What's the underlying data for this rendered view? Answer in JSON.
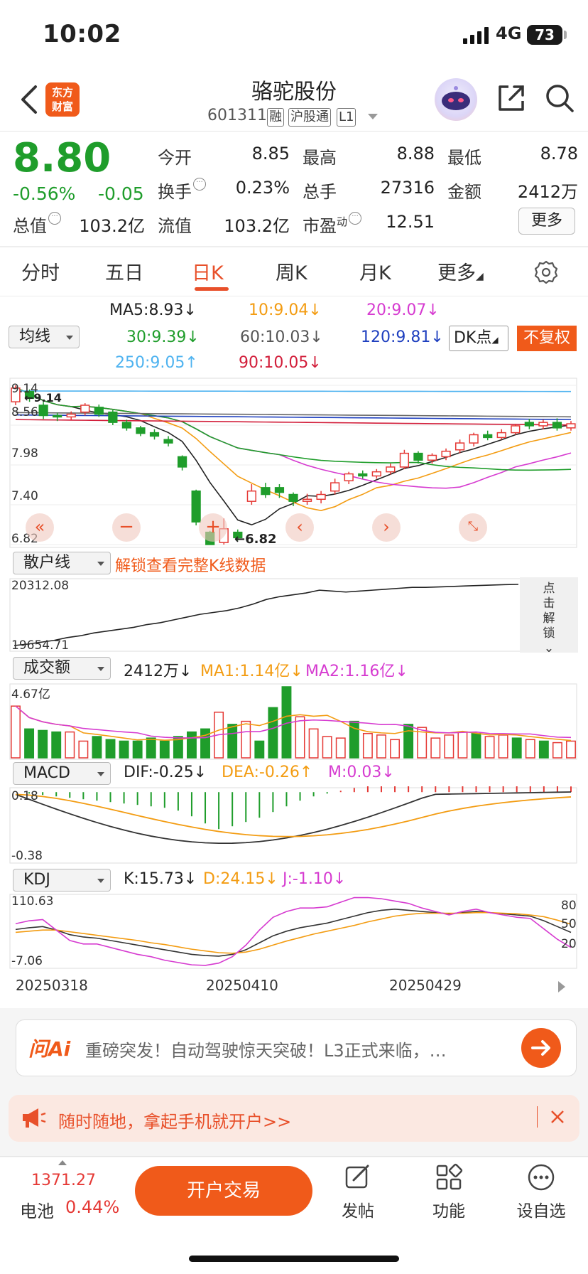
{
  "status": {
    "time": "10:02",
    "network": "4G",
    "battery": "73"
  },
  "header": {
    "logo_line1": "东方",
    "logo_line2": "财富",
    "name": "骆驼股份",
    "code": "601311",
    "tags": [
      "融",
      "沪股通",
      "L1"
    ]
  },
  "quote": {
    "price": "8.80",
    "pct": "-0.56%",
    "chg": "-0.05",
    "fields": [
      {
        "label": "今开",
        "value": "8.85"
      },
      {
        "label": "最高",
        "value": "8.88"
      },
      {
        "label": "最低",
        "value": "8.78"
      },
      {
        "label": "换手",
        "value": "0.23%"
      },
      {
        "label": "总手",
        "value": "27316"
      },
      {
        "label": "金额",
        "value": "2412万"
      },
      {
        "label": "总值",
        "value": "103.2亿"
      },
      {
        "label": "流值",
        "value": "103.2亿"
      },
      {
        "label": "市盈",
        "value": "12.51"
      }
    ],
    "pe_sup": "动",
    "more": "更多"
  },
  "tabs": [
    "分时",
    "五日",
    "日K",
    "周K",
    "月K",
    "更多"
  ],
  "ma": {
    "select": "均线",
    "ma5": "MA5:8.93",
    "ma10": "10:9.04",
    "ma20": "20:9.07",
    "ma30": "30:9.39",
    "ma60": "60:10.03",
    "ma120": "120:9.81",
    "ma250": "250:9.05",
    "ma90": "90:10.05",
    "dk": "DK点",
    "fq": "不复权"
  },
  "price_axis": [
    "9.14",
    "8.56",
    "7.98",
    "7.40",
    "6.82"
  ],
  "price_marks": {
    "high": "9.14",
    "low": "6.82"
  },
  "retail": {
    "select": "散户线",
    "unlock": "解锁查看完整K线数据",
    "ymax": "20312.08",
    "ymin": "19654.71",
    "side": [
      "点",
      "击",
      "解",
      "锁"
    ]
  },
  "volume": {
    "select": "成交额",
    "value": "2412万",
    "ma1": "MA1:1.14亿",
    "ma2": "MA2:1.16亿",
    "ymax": "4.67亿"
  },
  "macd": {
    "select": "MACD",
    "dif": "DIF:-0.25",
    "dea": "DEA:-0.26",
    "m": "M:0.03",
    "ymax": "0.18",
    "ymin": "-0.38"
  },
  "kdj": {
    "select": "KDJ",
    "k": "K:15.73",
    "d": "D:24.15",
    "j": "J:-1.10",
    "ymax": "110.63",
    "ymin": "-7.06",
    "right": [
      "80",
      "50",
      "20"
    ]
  },
  "dates": [
    "20250318",
    "20250410",
    "20250429"
  ],
  "ai": {
    "logo": "问Ai",
    "text": "重磅突发！自动驾驶惊天突破！L3正式来临，…"
  },
  "promo": {
    "text": "随时随地，拿起手机就开户>>"
  },
  "bottom": {
    "index_value": "1371.27",
    "index_name": "电池",
    "index_pct": "0.44%",
    "trade": "开户交易",
    "nav": [
      "发帖",
      "功能",
      "设自选"
    ]
  },
  "chart_data": [
    {
      "type": "candlestick",
      "series": [
        {
          "name": "MA5",
          "value": 8.93
        },
        {
          "name": "10",
          "value": 9.04
        },
        {
          "name": "20",
          "value": 9.07
        },
        {
          "name": "30",
          "value": 9.39
        },
        {
          "name": "60",
          "value": 10.03
        },
        {
          "name": "120",
          "value": 9.81
        },
        {
          "name": "250",
          "value": 9.05
        },
        {
          "name": "90",
          "value": 10.05
        }
      ],
      "ylim": [
        6.82,
        9.14
      ],
      "ticks": [
        9.14,
        8.56,
        7.98,
        7.4,
        6.82
      ],
      "annotations": [
        "9.14",
        "6.82"
      ],
      "candles": [
        {
          "o": 8.9,
          "c": 9.1,
          "h": 9.14,
          "l": 8.85
        },
        {
          "o": 9.05,
          "c": 8.95,
          "h": 9.08,
          "l": 8.9
        },
        {
          "o": 8.85,
          "c": 8.7,
          "h": 8.9,
          "l": 8.65
        },
        {
          "o": 8.7,
          "c": 8.68,
          "h": 8.74,
          "l": 8.62
        },
        {
          "o": 8.68,
          "c": 8.72,
          "h": 8.76,
          "l": 8.64
        },
        {
          "o": 8.75,
          "c": 8.85,
          "h": 8.88,
          "l": 8.7
        },
        {
          "o": 8.82,
          "c": 8.72,
          "h": 8.86,
          "l": 8.68
        },
        {
          "o": 8.75,
          "c": 8.6,
          "h": 8.78,
          "l": 8.56
        },
        {
          "o": 8.6,
          "c": 8.52,
          "h": 8.64,
          "l": 8.48
        },
        {
          "o": 8.52,
          "c": 8.44,
          "h": 8.55,
          "l": 8.4
        },
        {
          "o": 8.45,
          "c": 8.4,
          "h": 8.5,
          "l": 8.35
        },
        {
          "o": 8.35,
          "c": 8.3,
          "h": 8.4,
          "l": 8.25
        },
        {
          "o": 8.1,
          "c": 7.95,
          "h": 8.12,
          "l": 7.9
        },
        {
          "o": 7.6,
          "c": 7.15,
          "h": 7.62,
          "l": 7.1
        },
        {
          "o": 7.0,
          "c": 6.82,
          "h": 7.02,
          "l": 6.82
        },
        {
          "o": 6.85,
          "c": 7.05,
          "h": 7.2,
          "l": 6.82
        },
        {
          "o": 7.0,
          "c": 6.92,
          "h": 7.04,
          "l": 6.88
        },
        {
          "o": 7.45,
          "c": 7.6,
          "h": 7.7,
          "l": 7.4
        },
        {
          "o": 7.65,
          "c": 7.55,
          "h": 7.72,
          "l": 7.5
        },
        {
          "o": 7.65,
          "c": 7.58,
          "h": 7.7,
          "l": 7.5
        },
        {
          "o": 7.55,
          "c": 7.45,
          "h": 7.58,
          "l": 7.38
        },
        {
          "o": 7.45,
          "c": 7.48,
          "h": 7.56,
          "l": 7.4
        },
        {
          "o": 7.48,
          "c": 7.55,
          "h": 7.6,
          "l": 7.42
        },
        {
          "o": 7.6,
          "c": 7.72,
          "h": 7.78,
          "l": 7.55
        },
        {
          "o": 7.75,
          "c": 7.85,
          "h": 7.88,
          "l": 7.7
        },
        {
          "o": 7.85,
          "c": 7.82,
          "h": 7.9,
          "l": 7.78
        },
        {
          "o": 7.82,
          "c": 7.88,
          "h": 7.92,
          "l": 7.78
        },
        {
          "o": 7.88,
          "c": 7.95,
          "h": 8.0,
          "l": 7.84
        },
        {
          "o": 7.95,
          "c": 8.15,
          "h": 8.2,
          "l": 7.92
        },
        {
          "o": 8.15,
          "c": 8.05,
          "h": 8.18,
          "l": 8.0
        },
        {
          "o": 8.05,
          "c": 8.12,
          "h": 8.15,
          "l": 8.0
        },
        {
          "o": 8.1,
          "c": 8.18,
          "h": 8.22,
          "l": 8.05
        },
        {
          "o": 8.2,
          "c": 8.3,
          "h": 8.35,
          "l": 8.15
        },
        {
          "o": 8.3,
          "c": 8.42,
          "h": 8.45,
          "l": 8.25
        },
        {
          "o": 8.42,
          "c": 8.38,
          "h": 8.48,
          "l": 8.34
        },
        {
          "o": 8.38,
          "c": 8.45,
          "h": 8.5,
          "l": 8.35
        },
        {
          "o": 8.45,
          "c": 8.55,
          "h": 8.58,
          "l": 8.42
        },
        {
          "o": 8.6,
          "c": 8.55,
          "h": 8.65,
          "l": 8.5
        },
        {
          "o": 8.55,
          "c": 8.6,
          "h": 8.64,
          "l": 8.5
        },
        {
          "o": 8.6,
          "c": 8.52,
          "h": 8.66,
          "l": 8.48
        },
        {
          "o": 8.52,
          "c": 8.58,
          "h": 8.62,
          "l": 8.48
        }
      ],
      "xlabels": [
        "20250318",
        "20250410",
        "20250429"
      ]
    },
    {
      "type": "line",
      "title": "散户线",
      "ylim": [
        19654.71,
        20312.08
      ],
      "values": [
        19654.71,
        19670,
        19690,
        19710,
        19740,
        19760,
        19790,
        19810,
        19830,
        19850,
        19880,
        19900,
        19930,
        19960,
        19990,
        20010,
        20030,
        20060,
        20100,
        20150,
        20180,
        20200,
        20220,
        20250,
        20240,
        20230,
        20240,
        20250,
        20260,
        20270,
        20280,
        20280,
        20285,
        20290,
        20295,
        20300,
        20305,
        20310,
        20312.08
      ]
    },
    {
      "type": "bar",
      "title": "成交额",
      "ylim": [
        0,
        4.67
      ],
      "values": [
        3.4,
        1.9,
        1.8,
        1.7,
        1.7,
        1.1,
        1.4,
        1.2,
        1.1,
        1.1,
        1.3,
        1.1,
        1.4,
        1.7,
        1.9,
        3.0,
        2.2,
        2.4,
        1.1,
        3.3,
        4.67,
        2.7,
        1.9,
        1.4,
        1.3,
        2.4,
        1.6,
        1.5,
        1.2,
        2.2,
        2.0,
        1.3,
        1.5,
        1.7,
        1.6,
        1.4,
        1.5,
        1.3,
        1.2,
        1.1,
        1.0,
        1.1
      ],
      "series": [
        {
          "name": "MA1",
          "value": "1.14亿"
        },
        {
          "name": "MA2",
          "value": "1.16亿"
        }
      ]
    },
    {
      "type": "bar",
      "title": "MACD",
      "ylim": [
        -0.38,
        0.18
      ],
      "values": [
        0.0,
        -0.01,
        -0.02,
        -0.03,
        -0.04,
        -0.05,
        -0.06,
        -0.07,
        -0.08,
        -0.09,
        -0.1,
        -0.11,
        -0.13,
        -0.17,
        -0.22,
        -0.26,
        -0.24,
        -0.21,
        -0.18,
        -0.14,
        -0.1,
        -0.06,
        -0.03,
        -0.01,
        0.01,
        0.03,
        0.05,
        0.07,
        0.09,
        0.11,
        0.12,
        0.12,
        0.12,
        0.12,
        0.12,
        0.11,
        0.1,
        0.09,
        0.08,
        0.06,
        0.05,
        0.04
      ],
      "series": [
        {
          "name": "DIF",
          "value": -0.25
        },
        {
          "name": "DEA",
          "value": -0.26
        },
        {
          "name": "M",
          "value": 0.03
        }
      ]
    },
    {
      "type": "line",
      "title": "KDJ",
      "ylim": [
        -7.06,
        110.63
      ],
      "series": [
        {
          "name": "K",
          "value": 15.73
        },
        {
          "name": "D",
          "value": 24.15
        },
        {
          "name": "J",
          "value": -1.1
        }
      ],
      "k": [
        55,
        58,
        60,
        54,
        46,
        42,
        40,
        36,
        32,
        28,
        24,
        20,
        16,
        12,
        10,
        9,
        12,
        20,
        32,
        44,
        52,
        58,
        62,
        66,
        72,
        78,
        84,
        88,
        90,
        88,
        86,
        84,
        82,
        84,
        86,
        84,
        82,
        80,
        78,
        70,
        60,
        50
      ],
      "d": [
        50,
        52,
        54,
        54,
        51,
        48,
        45,
        42,
        39,
        36,
        32,
        29,
        25,
        21,
        18,
        15,
        14,
        16,
        21,
        28,
        35,
        41,
        47,
        52,
        57,
        62,
        68,
        73,
        78,
        81,
        83,
        83,
        83,
        83,
        84,
        84,
        83,
        82,
        80,
        77,
        71,
        64
      ],
      "j": [
        65,
        70,
        72,
        54,
        36,
        30,
        30,
        24,
        18,
        12,
        8,
        2,
        -2,
        -6,
        -7,
        -3,
        8,
        28,
        54,
        76,
        86,
        92,
        92,
        94,
        102,
        110,
        110,
        108,
        104,
        100,
        92,
        86,
        80,
        86,
        90,
        84,
        80,
        76,
        74,
        56,
        38,
        24
      ]
    }
  ]
}
